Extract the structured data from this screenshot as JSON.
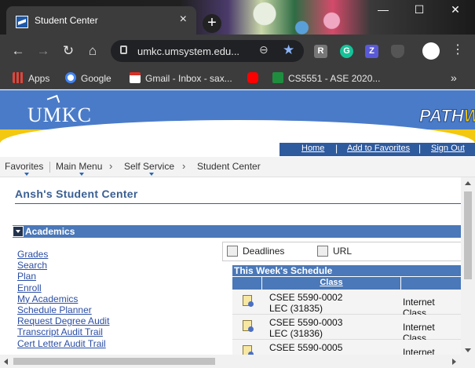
{
  "browser": {
    "tab_title": "Student Center",
    "tab_close": "×",
    "new_tab": "+",
    "window_controls": {
      "minimize": "—",
      "maximize": "☐",
      "close": "✕"
    },
    "back": "←",
    "forward": "→",
    "reload": "↻",
    "home": "⌂",
    "url": "umkc.umsystem.edu...",
    "zoom_icon": "⊖",
    "star_icon": "★",
    "menu": "⋮",
    "bookmarks": [
      {
        "label": "Apps",
        "icon": "apps-grid-icon",
        "color": "#e0453b"
      },
      {
        "label": "Google",
        "icon": "google-icon",
        "color": "#4285f4"
      },
      {
        "label": "Gmail - Inbox - sax...",
        "icon": "gmail-icon",
        "color": "#d93025"
      },
      {
        "label": "",
        "icon": "youtube-icon",
        "color": "#ff0000"
      },
      {
        "label": "CS5551 - ASE 2020...",
        "icon": "bookmark-plus-icon",
        "color": "#1e8e3e"
      }
    ],
    "bookmarks_more": "»"
  },
  "header": {
    "logo": "UMKC",
    "pathway_main": "PATH",
    "pathway_tail": "W",
    "nav": [
      {
        "label": "Home"
      },
      {
        "label": "Add to Favorites"
      },
      {
        "label": "Sign Out"
      }
    ]
  },
  "breadcrumb": {
    "items": [
      "Favorites",
      "Main Menu",
      "Self Service",
      "Student Center"
    ],
    "separator": "›"
  },
  "main": {
    "page_title": "Ansh's Student Center",
    "section_title": "Academics",
    "links": [
      "Grades",
      "Search",
      "Plan",
      "Enroll",
      "My Academics",
      "Schedule Planner",
      "Request Degree Audit",
      "Transcript Audit Trail",
      "Cert Letter Audit Trail"
    ],
    "quick_links": [
      {
        "label": "Deadlines",
        "icon": "deadlines-icon"
      },
      {
        "label": "URL",
        "icon": "url-icon"
      }
    ],
    "schedule": {
      "title": "This Week's Schedule",
      "column_class": "Class",
      "rows": [
        {
          "line1": "CSEE 5590-0002",
          "line2": "LEC (31835)",
          "type": "Internet Class"
        },
        {
          "line1": "CSEE 5590-0003",
          "line2": "LEC (31836)",
          "type": "Internet Class"
        },
        {
          "line1": "CSEE 5590-0005",
          "line2": "",
          "type": "Internet Class"
        }
      ]
    }
  },
  "colors": {
    "header_blue": "#4a7bc8",
    "section_blue": "#4a78b8",
    "accent_yellow": "#f2c811",
    "link": "#2b4ea4"
  }
}
